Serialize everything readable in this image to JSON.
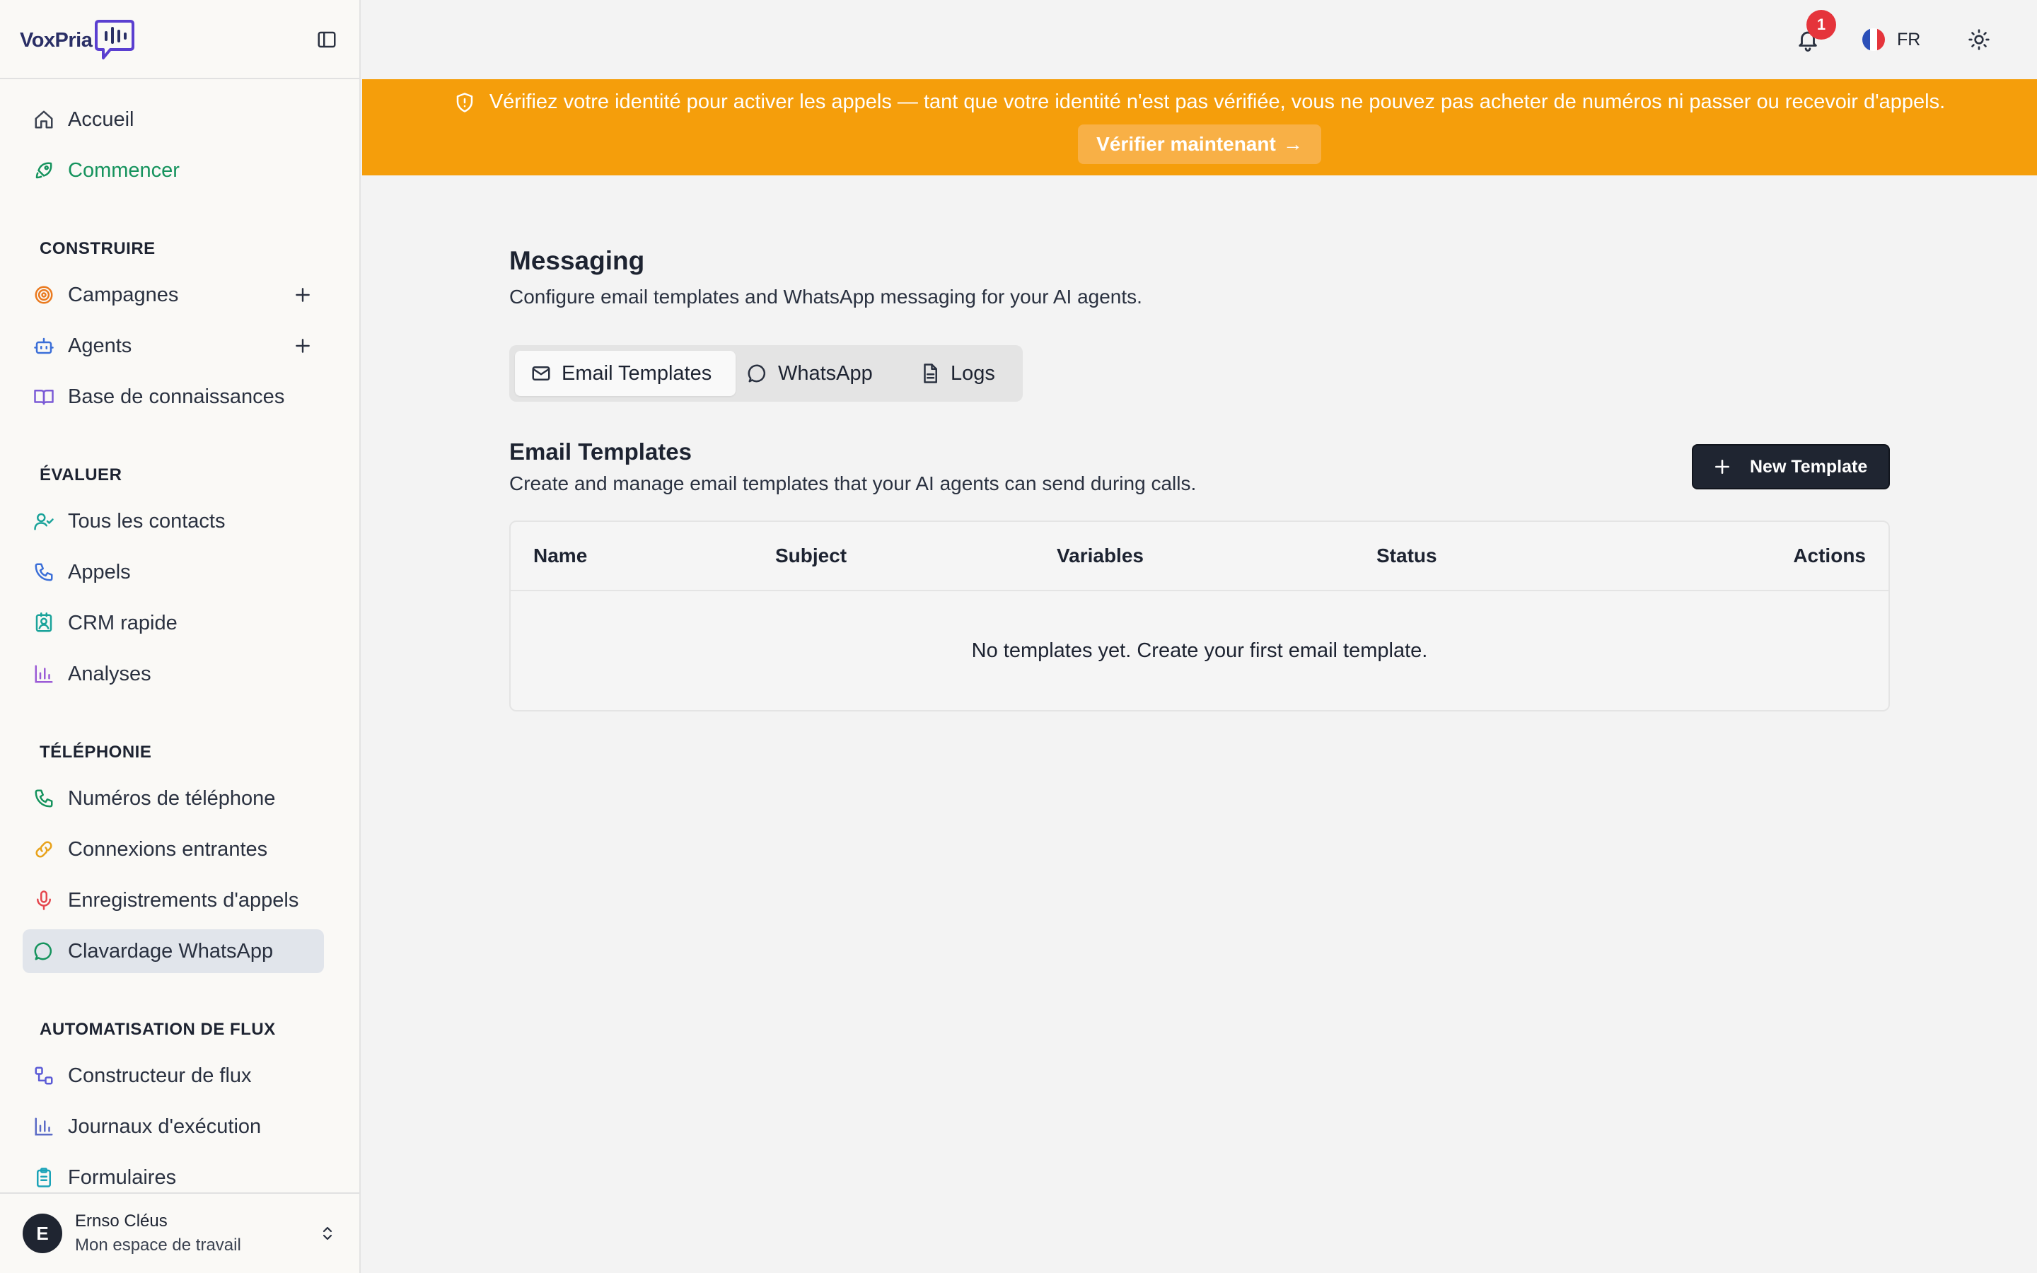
{
  "brand": {
    "name": "VoxPria"
  },
  "sidebar": {
    "top_items": [
      {
        "label": "Accueil",
        "icon": "home-icon"
      },
      {
        "label": "Commencer",
        "icon": "rocket-icon"
      }
    ],
    "sections": [
      {
        "title": "CONSTRUIRE",
        "items": [
          {
            "label": "Campagnes",
            "icon": "target-icon",
            "addable": true
          },
          {
            "label": "Agents",
            "icon": "bot-icon",
            "addable": true
          },
          {
            "label": "Base de connaissances",
            "icon": "book-icon"
          }
        ]
      },
      {
        "title": "ÉVALUER",
        "items": [
          {
            "label": "Tous les contacts",
            "icon": "user-check-icon"
          },
          {
            "label": "Appels",
            "icon": "phone-icon"
          },
          {
            "label": "CRM rapide",
            "icon": "contact-card-icon"
          },
          {
            "label": "Analyses",
            "icon": "bar-chart-icon"
          }
        ]
      },
      {
        "title": "TÉLÉPHONIE",
        "items": [
          {
            "label": "Numéros de téléphone",
            "icon": "phone-icon"
          },
          {
            "label": "Connexions entrantes",
            "icon": "link-icon"
          },
          {
            "label": "Enregistrements d'appels",
            "icon": "mic-icon"
          },
          {
            "label": "Clavardage WhatsApp",
            "icon": "chat-icon",
            "active": true
          }
        ]
      },
      {
        "title": "AUTOMATISATION DE FLUX",
        "items": [
          {
            "label": "Constructeur de flux",
            "icon": "workflow-icon"
          },
          {
            "label": "Journaux d'exécution",
            "icon": "bar-chart-icon"
          },
          {
            "label": "Formulaires",
            "icon": "clipboard-icon"
          }
        ]
      }
    ],
    "user": {
      "initial": "E",
      "name": "Ernso Cléus",
      "workspace": "Mon espace de travail"
    }
  },
  "topbar": {
    "notifications_count": "1",
    "language": "FR"
  },
  "banner": {
    "text": "Vérifiez votre identité pour activer les appels — tant que votre identité n'est pas vérifiée, vous ne pouvez pas acheter de numéros ni passer ou recevoir d'appels.",
    "button_label": "Vérifier maintenant",
    "button_arrow": "→"
  },
  "main": {
    "title": "Messaging",
    "subtitle": "Configure email templates and WhatsApp messaging for your AI agents.",
    "tabs": [
      {
        "label": "Email Templates",
        "icon": "mail-icon",
        "active": true
      },
      {
        "label": "WhatsApp",
        "icon": "chat-icon"
      },
      {
        "label": "Logs",
        "icon": "file-text-icon"
      }
    ],
    "section": {
      "title": "Email Templates",
      "subtitle": "Create and manage email templates that your AI agents can send during calls.",
      "new_button": "New Template"
    },
    "table": {
      "columns": [
        "Name",
        "Subject",
        "Variables",
        "Status",
        "Actions"
      ],
      "empty_message": "No templates yet. Create your first email template."
    }
  },
  "colors": {
    "banner": "#f59e0b",
    "accent_green": "#15935d",
    "primary_dark": "#1f2531",
    "badge_red": "#e5343b"
  }
}
